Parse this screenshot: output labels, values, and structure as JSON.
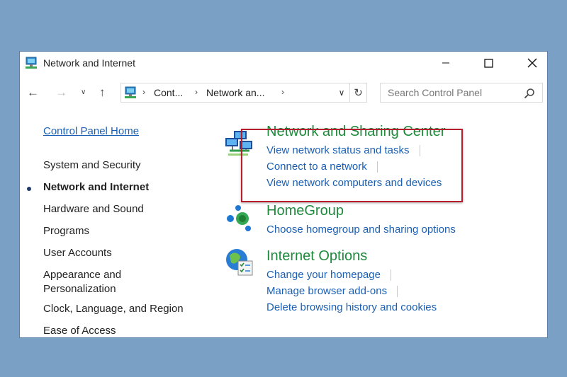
{
  "window": {
    "title": "Network and Internet",
    "minimize_icon": "minimize-icon",
    "maximize_icon": "maximize-icon",
    "close_icon": "close-icon"
  },
  "navbar": {
    "back_icon": "back-arrow-icon",
    "forward_icon": "forward-arrow-icon",
    "recent_icon": "recent-locations-chevron-icon",
    "up_icon": "up-arrow-icon",
    "address": {
      "crumb1": "Cont...",
      "crumb2": "Network an...",
      "sep": "›"
    },
    "search_placeholder": "Search Control Panel"
  },
  "sidebar": {
    "home_label": "Control Panel Home",
    "items": [
      {
        "label": "System and Security",
        "active": false
      },
      {
        "label": "Network and Internet",
        "active": true
      },
      {
        "label": "Hardware and Sound",
        "active": false
      },
      {
        "label": "Programs",
        "active": false
      },
      {
        "label": "User Accounts",
        "active": false
      },
      {
        "label": "Appearance and",
        "label2": "Personalization",
        "active": false
      },
      {
        "label": "Clock, Language, and Region",
        "active": false
      },
      {
        "label": "Ease of Access",
        "active": false
      }
    ]
  },
  "categories": [
    {
      "title": "Network and Sharing Center",
      "icon": "network-sharing-center-icon",
      "links": [
        "View network status and tasks",
        "Connect to a network",
        "View network computers and devices"
      ]
    },
    {
      "title": "HomeGroup",
      "icon": "homegroup-icon",
      "links": [
        "Choose homegroup and sharing options"
      ]
    },
    {
      "title": "Internet Options",
      "icon": "internet-options-icon",
      "links": [
        "Change your homepage",
        "Manage browser add-ons",
        "Delete browsing history and cookies"
      ]
    }
  ],
  "colors": {
    "background": "#7ba0c6",
    "link": "#1a5fb4",
    "category_title": "#1f8a3c",
    "highlight": "#b61e2e"
  }
}
